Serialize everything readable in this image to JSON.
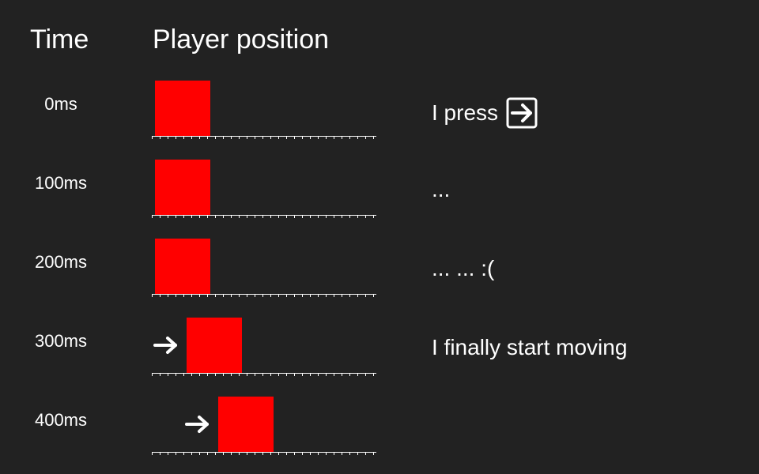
{
  "headers": {
    "time": "Time",
    "position": "Player position"
  },
  "colors": {
    "background": "#222222",
    "player": "#ff0000",
    "foreground": "#ffffff"
  },
  "ruler": {
    "units": 14
  },
  "rows": [
    {
      "time": "0ms",
      "position_units": 0,
      "moving": false,
      "comment": "I press",
      "comment_icon": "right-arrow-key-icon"
    },
    {
      "time": "100ms",
      "position_units": 0,
      "moving": false,
      "comment": "...",
      "comment_icon": ""
    },
    {
      "time": "200ms",
      "position_units": 0,
      "moving": false,
      "comment": "... ... :(",
      "comment_icon": ""
    },
    {
      "time": "300ms",
      "position_units": 2,
      "moving": true,
      "comment": "I finally start moving",
      "comment_icon": ""
    },
    {
      "time": "400ms",
      "position_units": 4,
      "moving": true,
      "comment": "",
      "comment_icon": ""
    }
  ]
}
